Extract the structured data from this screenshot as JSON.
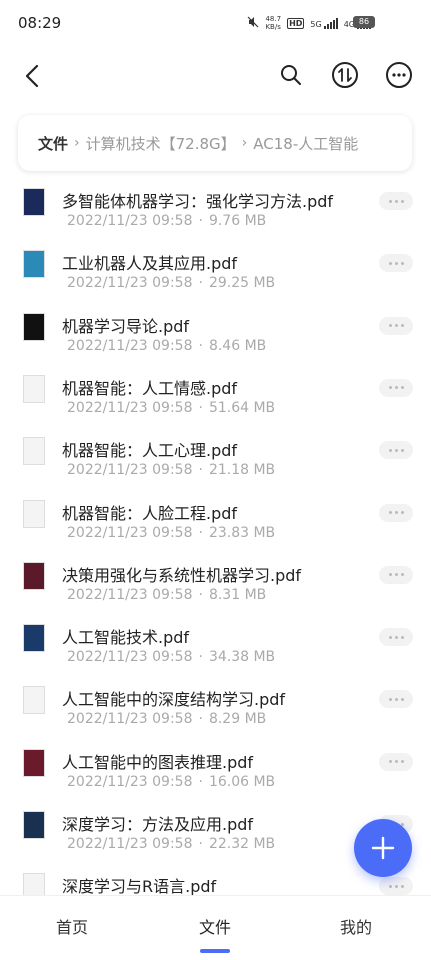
{
  "status_bar": {
    "time": "08:29",
    "net_speed": "48.7",
    "net_unit": "KB/s",
    "hd": "HD",
    "net1": "5G",
    "net2": "4G",
    "battery": "86"
  },
  "breadcrumb": {
    "root": "文件",
    "items": [
      "计算机技术【72.8G】",
      "AC18-人工智能"
    ]
  },
  "files": [
    {
      "name": "多智能体机器学习：强化学习方法.pdf",
      "date": "2022/11/23 09:58",
      "size": "9.76 MB",
      "thumb_color": "#1a2a5a"
    },
    {
      "name": "工业机器人及其应用.pdf",
      "date": "2022/11/23 09:58",
      "size": "29.25 MB",
      "thumb_color": "#2b8ab8"
    },
    {
      "name": "机器学习导论.pdf",
      "date": "2022/11/23 09:58",
      "size": "8.46 MB",
      "thumb_color": "#111111"
    },
    {
      "name": "机器智能：人工情感.pdf",
      "date": "2022/11/23 09:58",
      "size": "51.64 MB",
      "thumb_color": "#f4f4f4"
    },
    {
      "name": "机器智能：人工心理.pdf",
      "date": "2022/11/23 09:58",
      "size": "21.18 MB",
      "thumb_color": "#f4f4f4"
    },
    {
      "name": "机器智能：人脸工程.pdf",
      "date": "2022/11/23 09:58",
      "size": "23.83 MB",
      "thumb_color": "#f4f4f4"
    },
    {
      "name": "决策用强化与系统性机器学习.pdf",
      "date": "2022/11/23 09:58",
      "size": "8.31 MB",
      "thumb_color": "#5a1a2a"
    },
    {
      "name": "人工智能技术.pdf",
      "date": "2022/11/23 09:58",
      "size": "34.38 MB",
      "thumb_color": "#1a3a6a"
    },
    {
      "name": "人工智能中的深度结构学习.pdf",
      "date": "2022/11/23 09:58",
      "size": "8.29 MB",
      "thumb_color": "#f4f4f4"
    },
    {
      "name": "人工智能中的图表推理.pdf",
      "date": "2022/11/23 09:58",
      "size": "16.06 MB",
      "thumb_color": "#6a1a2a"
    },
    {
      "name": "深度学习：方法及应用.pdf",
      "date": "2022/11/23 09:58",
      "size": "22.32 MB",
      "thumb_color": "#1a3050"
    },
    {
      "name": "深度学习与R语言.pdf",
      "date": "",
      "size": "",
      "thumb_color": "#f4f4f4"
    }
  ],
  "bottom_nav": {
    "home": "首页",
    "files": "文件",
    "mine": "我的"
  },
  "colors": {
    "accent": "#4a6cf7"
  },
  "icons": {
    "back": "chevron-left-icon",
    "search": "search-icon",
    "sort": "sort-icon",
    "more": "more-icon",
    "fab": "plus-icon"
  }
}
